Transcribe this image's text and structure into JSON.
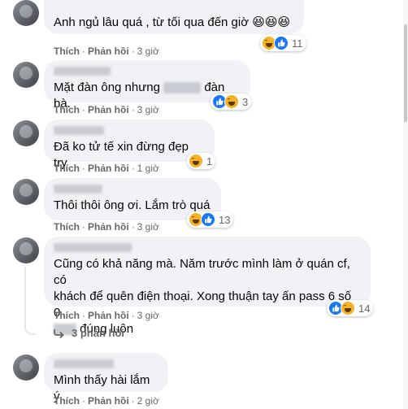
{
  "actions": {
    "like": "Thích",
    "reply": "Phản hồi",
    "sep": "·"
  },
  "comments": [
    {
      "text": "Anh ngủ lâu quá , từ tối qua đến giờ 😆😆😆",
      "time": "3 giờ",
      "reactions": [
        "haha",
        "like"
      ],
      "count": "11"
    },
    {
      "text_before": "Mặt đàn ông nhưng",
      "text_after": "đàn bà.",
      "time": "3 giờ",
      "reactions": [
        "like",
        "haha"
      ],
      "count": "3"
    },
    {
      "text": "Đã ko tử tế xin đừng đẹp try",
      "time": "1 giờ",
      "reactions": [
        "haha"
      ],
      "count": "1"
    },
    {
      "text": "Thôi thôi ông ơi. Lắm trò quá",
      "time": "3 giờ",
      "reactions": [
        "haha",
        "like"
      ],
      "count": "13"
    },
    {
      "line1": "Cũng có khả năng mà. Năm trước mình làm ở quán cf, có",
      "line2": "khách để quên điện thoại. Xong thuận tay ấn pass 6 số 0",
      "line3_after": "đúng luôn",
      "time": "3 giờ",
      "reactions": [
        "like",
        "haha"
      ],
      "count": "14",
      "replies": "3 phản hồi"
    },
    {
      "text": "Mình thấy hài lắm ý",
      "time": "2 giờ"
    }
  ],
  "colors": {
    "bubble": "#f0f2f5",
    "meta": "#65676b",
    "like": "#1877f2",
    "haha": "#f7b125"
  }
}
